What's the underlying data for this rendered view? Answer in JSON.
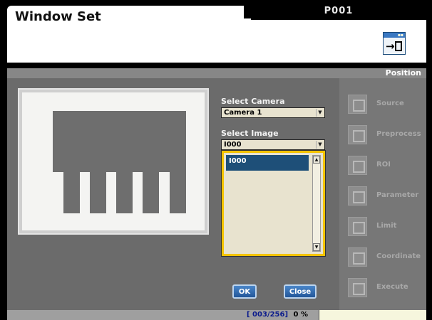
{
  "window": {
    "title": "Window Set",
    "program_tab": "P001"
  },
  "section": {
    "label": "Position"
  },
  "camera": {
    "label": "Select Camera",
    "value": "Camera 1"
  },
  "image": {
    "label": "Select Image",
    "value": "I000",
    "list_items": [
      "I000"
    ]
  },
  "buttons": {
    "ok": "OK",
    "close": "Close"
  },
  "nav": [
    {
      "label": "Source",
      "icon": "source-icon"
    },
    {
      "label": "Preprocess",
      "icon": "preprocess-icon"
    },
    {
      "label": "ROI",
      "icon": "roi-icon"
    },
    {
      "label": "Parameter",
      "icon": "parameter-icon"
    },
    {
      "label": "Limit",
      "icon": "limit-icon"
    },
    {
      "label": "Coordinate",
      "icon": "coordinate-icon"
    },
    {
      "label": "Execute",
      "icon": "execute-icon"
    }
  ],
  "status": {
    "counter": "[ 003/256]",
    "percent": "0 %"
  },
  "colors": {
    "accent_yellow": "#f4c400",
    "selected_blue": "#1e4f78",
    "button_blue": "#2f6cb0"
  }
}
